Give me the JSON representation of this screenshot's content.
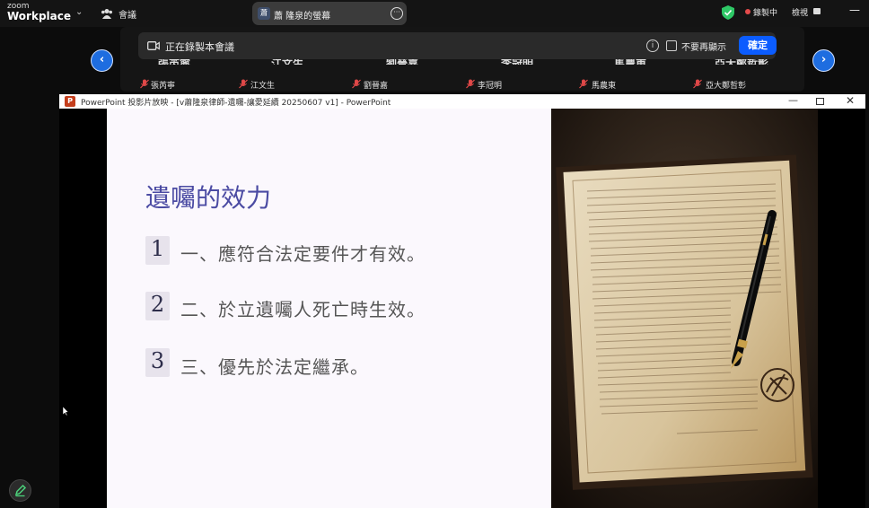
{
  "app": {
    "logo_top": "zoom",
    "logo_bottom": "Workplace",
    "meeting_label": "會議",
    "share_avatar": "蕭",
    "share_title": "蕭 隆泉的螢幕",
    "recording_status": "錄製中",
    "view_label": "檢視"
  },
  "recording_banner": {
    "message": "正在錄製本會議",
    "dont_show_label": "不要再顯示",
    "ok_label": "確定"
  },
  "participants": [
    {
      "name": "張芮寧",
      "status": "muted"
    },
    {
      "name": "江文生",
      "status": "muted"
    },
    {
      "name": "劉晉嘉",
      "status": "muted"
    },
    {
      "name": "李冠明",
      "status": "muted"
    },
    {
      "name": "馬農東",
      "status": "muted"
    },
    {
      "name": "亞大鄭哲彰",
      "status": "muted"
    }
  ],
  "participant_tiles_top": [
    "張芮寧",
    "江文生",
    "劉晉嘉",
    "李冠明",
    "馬農東",
    "亞大鄭哲彰"
  ],
  "ppt_window": {
    "title": "PowerPoint 投影片放映 - [v蕭隆泉律師-遺囑-讓愛延續 20250607 v1] - PowerPoint",
    "icon_letter": "P",
    "min_glyph": "—",
    "close_glyph": "✕"
  },
  "slide": {
    "title": "遺囑的效力",
    "items": [
      {
        "num": "1",
        "text": "一、應符合法定要件才有效。"
      },
      {
        "num": "2",
        "text": "二、於立遺囑人死亡時生效。"
      },
      {
        "num": "3",
        "text": "三、優先於法定繼承。"
      }
    ]
  },
  "colors": {
    "accent": "#0b5cff",
    "slide_title": "#4b4ba3",
    "recording": "#e54b4b"
  },
  "icons": [
    "chevron-down-icon",
    "meeting-icon",
    "more-icon",
    "shield-icon",
    "record-dot-icon",
    "view-icon",
    "camera-icon",
    "info-icon",
    "mic-off-icon",
    "arrow-left-icon",
    "arrow-right-icon",
    "annotate-icon"
  ]
}
